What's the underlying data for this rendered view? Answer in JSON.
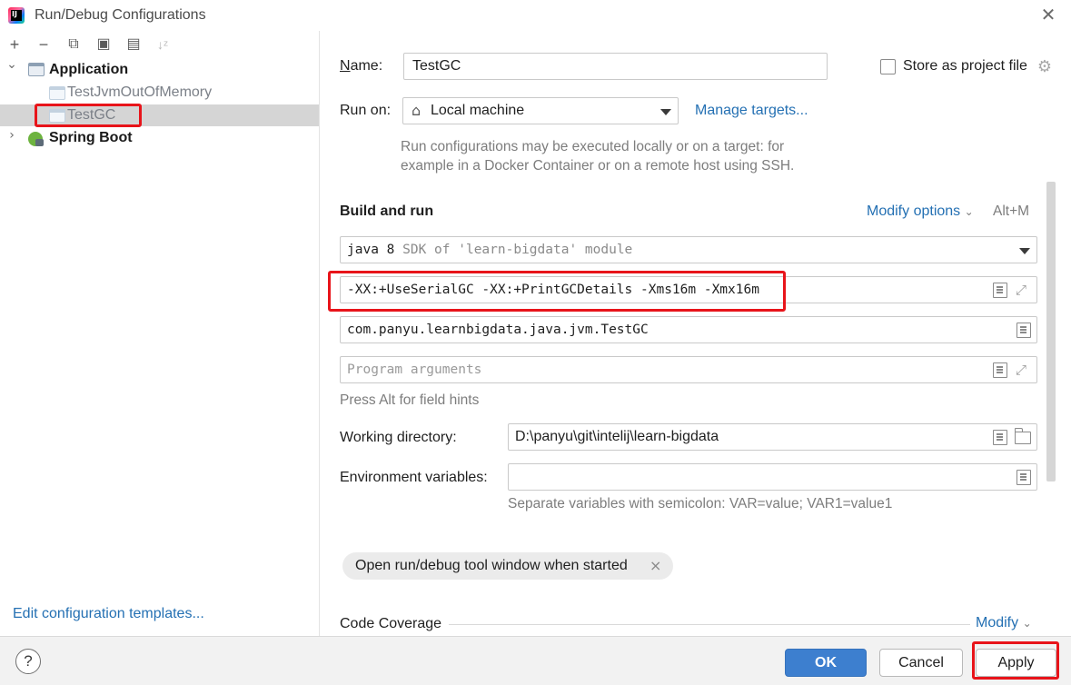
{
  "window": {
    "title": "Run/Debug Configurations",
    "close": "✕",
    "logo_text": "IJ"
  },
  "toolbar": {
    "add": "+",
    "remove": "−",
    "copy": "⧉",
    "save": "▣",
    "folder": "▤",
    "sort": "↓ᶻ"
  },
  "tree": {
    "expanded_arrow": "⌄",
    "collapsed_arrow": "›",
    "application": "Application",
    "items": [
      "TestJvmOutOfMemory",
      "TestGC"
    ],
    "spring_boot": "Spring Boot"
  },
  "left_footer": {
    "edit_templates": "Edit configuration templates..."
  },
  "form": {
    "name_label": "Name:",
    "name_value": "TestGC",
    "store_label": "Store as project file",
    "run_on_label": "Run on:",
    "run_on_value": "Local machine",
    "manage_targets": "Manage targets...",
    "run_on_hint_1": "Run configurations may be executed locally or on a target: for",
    "run_on_hint_2": "example in a Docker Container or on a remote host using SSH.",
    "build_and_run": "Build and run",
    "modify_options": "Modify options",
    "modify_shortcut": "Alt+M",
    "jdk_main": "java 8",
    "jdk_sub": "SDK of 'learn-bigdata' module",
    "vm_options": "-XX:+UseSerialGC -XX:+PrintGCDetails -Xms16m -Xmx16m",
    "main_class": "com.panyu.learnbigdata.java.jvm.TestGC",
    "program_args_placeholder": "Program arguments",
    "alt_hint": "Press Alt for field hints",
    "working_dir_label": "Working directory:",
    "working_dir_value": "D:\\panyu\\git\\intelij\\learn-bigdata",
    "env_label": "Environment variables:",
    "env_hint": "Separate variables with semicolon: VAR=value; VAR1=value1",
    "chip_label": "Open run/debug tool window when started",
    "chip_close": "×",
    "code_coverage": "Code Coverage",
    "modify": "Modify"
  },
  "footer": {
    "help": "?",
    "ok": "OK",
    "cancel": "Cancel",
    "apply": "Apply"
  },
  "colors": {
    "accent": "#2470b3",
    "ok_button": "#3d7fcf",
    "highlight": "#e8141a",
    "selection": "#d5d5d5"
  }
}
